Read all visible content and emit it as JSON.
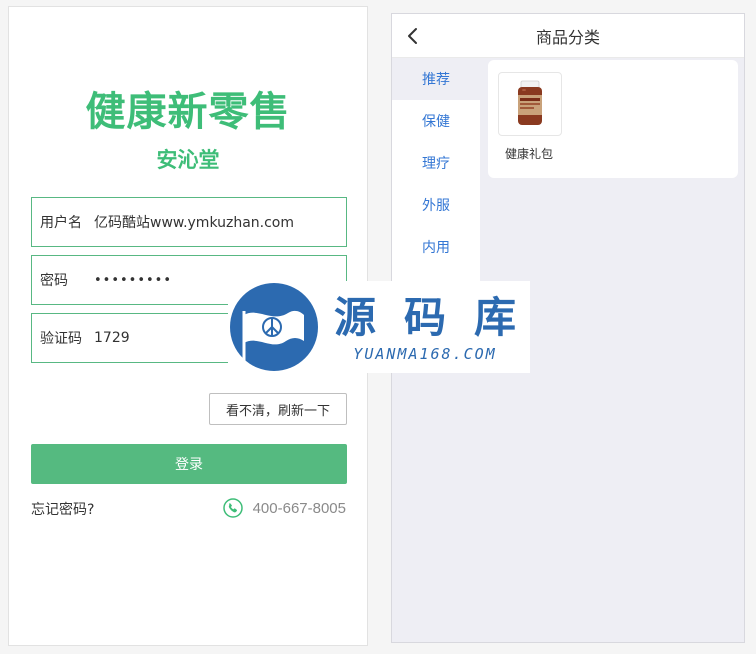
{
  "login": {
    "title": "健康新零售",
    "store_name": "安沁堂",
    "username": {
      "label": "用户名",
      "value": "亿码酷站www.ymkuzhan.com"
    },
    "password": {
      "label": "密码",
      "value": "•••••••••"
    },
    "captcha": {
      "label": "验证码",
      "value": "1729"
    },
    "refresh_button": "看不清，刷新一下",
    "login_button": "登录",
    "forgot_password": "忘记密码?",
    "hotline": "400-667-8005",
    "accent_color": "#3ebd78"
  },
  "category": {
    "title": "商品分类",
    "tabs": [
      "推荐",
      "保健",
      "理疗",
      "外服",
      "内用"
    ],
    "active_tab": "推荐",
    "product": {
      "name": "健康礼包"
    }
  },
  "watermark": {
    "main_text": "源码库",
    "sub_text": "YUANMA168.COM"
  }
}
